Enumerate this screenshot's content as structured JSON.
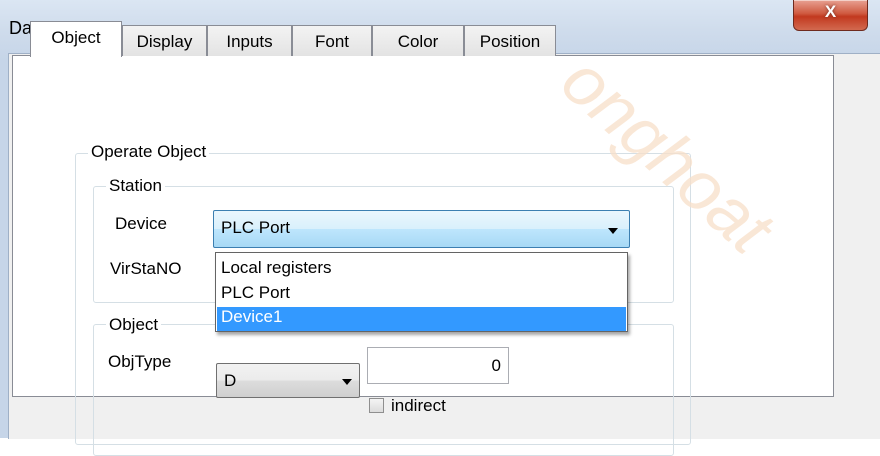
{
  "window": {
    "title": "Data Input",
    "close_label": "X"
  },
  "tabs": [
    "Object",
    "Display",
    "Inputs",
    "Font",
    "Color",
    "Position"
  ],
  "operate_object": {
    "legend": "Operate Object",
    "station": {
      "legend": "Station",
      "device_label": "Device",
      "device_value": "PLC Port",
      "virstano_label": "VirStaNO",
      "device_options": [
        "Local registers",
        "PLC Port",
        "Device1"
      ],
      "highlighted_option": "Device1"
    },
    "object": {
      "legend": "Object",
      "objtype_label": "ObjType",
      "objtype_value": "D",
      "address_value": "0",
      "indirect_label": "indirect"
    }
  },
  "watermark": "onghoat"
}
